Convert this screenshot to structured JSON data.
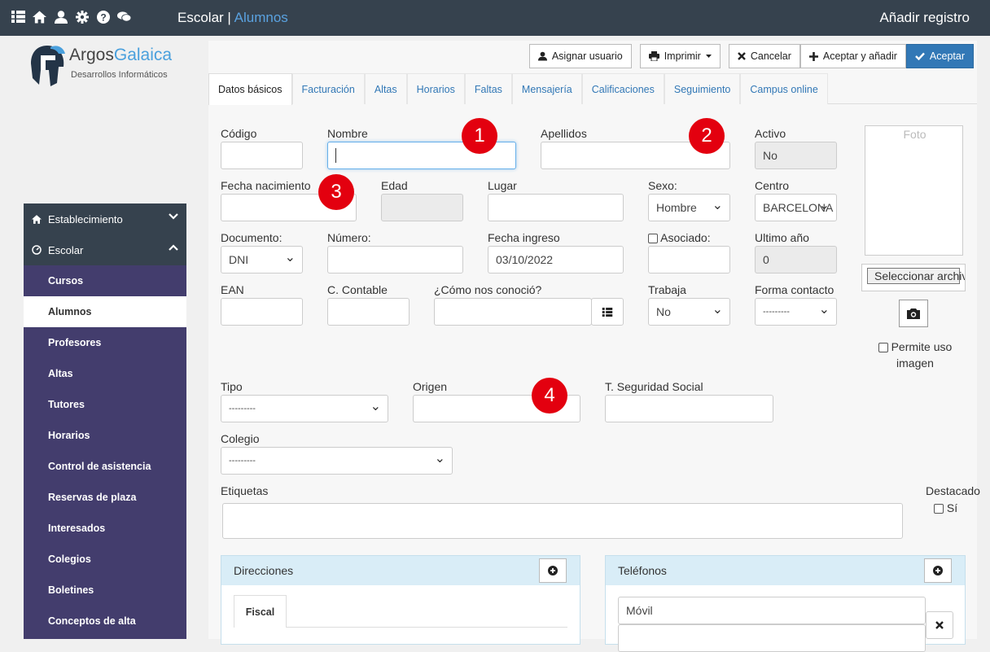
{
  "topbar": {
    "icons": [
      "list-icon",
      "home-icon",
      "user-icon",
      "gear-icon",
      "help-icon",
      "chat-icon"
    ],
    "title": "Escolar",
    "separator": "|",
    "subtitle": "Alumnos",
    "right": "Añadir registro"
  },
  "logo": {
    "name_a": "Argos",
    "name_b": "Galaica",
    "tagline": "Desarrollos Informáticos"
  },
  "sidebar": {
    "sections": [
      {
        "label": "Establecimiento",
        "icon": "home-icon",
        "chevron": "chevron-down-icon"
      },
      {
        "label": "Escolar",
        "icon": "dashboard-icon",
        "chevron": "chevron-up-icon"
      }
    ],
    "items": [
      "Cursos",
      "Alumnos",
      "Profesores",
      "Altas",
      "Tutores",
      "Horarios",
      "Control de asistencia",
      "Reservas de plaza",
      "Interesados",
      "Colegios",
      "Boletines",
      "Conceptos de alta"
    ],
    "active": "Alumnos"
  },
  "toolbar": {
    "assign": "Asignar usuario",
    "print": "Imprimir",
    "cancel": "Cancelar",
    "accept_add": "Aceptar y añadir",
    "accept": "Aceptar"
  },
  "tabs": [
    "Datos básicos",
    "Facturación",
    "Altas",
    "Horarios",
    "Faltas",
    "Mensajería",
    "Calificaciones",
    "Seguimiento",
    "Campus online"
  ],
  "form": {
    "codigo": {
      "label": "Código",
      "value": ""
    },
    "nombre": {
      "label": "Nombre",
      "value": ""
    },
    "apellidos": {
      "label": "Apellidos",
      "value": ""
    },
    "activo": {
      "label": "Activo",
      "value": "No"
    },
    "fecha_nacimiento": {
      "label": "Fecha nacimiento",
      "value": ""
    },
    "edad": {
      "label": "Edad",
      "value": ""
    },
    "lugar": {
      "label": "Lugar",
      "value": ""
    },
    "sexo": {
      "label": "Sexo:",
      "value": "Hombre"
    },
    "centro": {
      "label": "Centro",
      "value": "BARCELONA"
    },
    "documento": {
      "label": "Documento:",
      "value": "DNI"
    },
    "numero": {
      "label": "Número:",
      "value": ""
    },
    "fecha_ingreso": {
      "label": "Fecha ingreso",
      "value": "03/10/2022"
    },
    "asociado": {
      "label": "Asociado:",
      "value": ""
    },
    "ultimo_anio": {
      "label": "Ultimo año",
      "value": "0"
    },
    "ean": {
      "label": "EAN",
      "value": ""
    },
    "c_contable": {
      "label": "C. Contable",
      "value": ""
    },
    "como_conocio": {
      "label": "¿Cómo nos conoció?",
      "value": ""
    },
    "trabaja": {
      "label": "Trabaja",
      "value": "No"
    },
    "forma_contacto": {
      "label": "Forma contacto",
      "value": "---------"
    },
    "tipo": {
      "label": "Tipo",
      "value": "---------"
    },
    "origen": {
      "label": "Origen",
      "value": ""
    },
    "seguridad_social": {
      "label": "T. Seguridad Social",
      "value": ""
    },
    "colegio": {
      "label": "Colegio",
      "value": "---------"
    },
    "etiquetas": {
      "label": "Etiquetas",
      "value": ""
    },
    "destacado": {
      "label": "Destacado",
      "option": "Sí"
    }
  },
  "foto": {
    "placeholder": "Foto",
    "file_button": "Seleccionar archivo",
    "permite_uso_1": "Permite uso",
    "permite_uso_2": "imagen"
  },
  "badges": [
    "1",
    "2",
    "3",
    "4"
  ],
  "panels": {
    "direcciones": {
      "title": "Direcciones",
      "tab": "Fiscal"
    },
    "telefonos": {
      "title": "Teléfonos",
      "first": "Móvil"
    }
  }
}
